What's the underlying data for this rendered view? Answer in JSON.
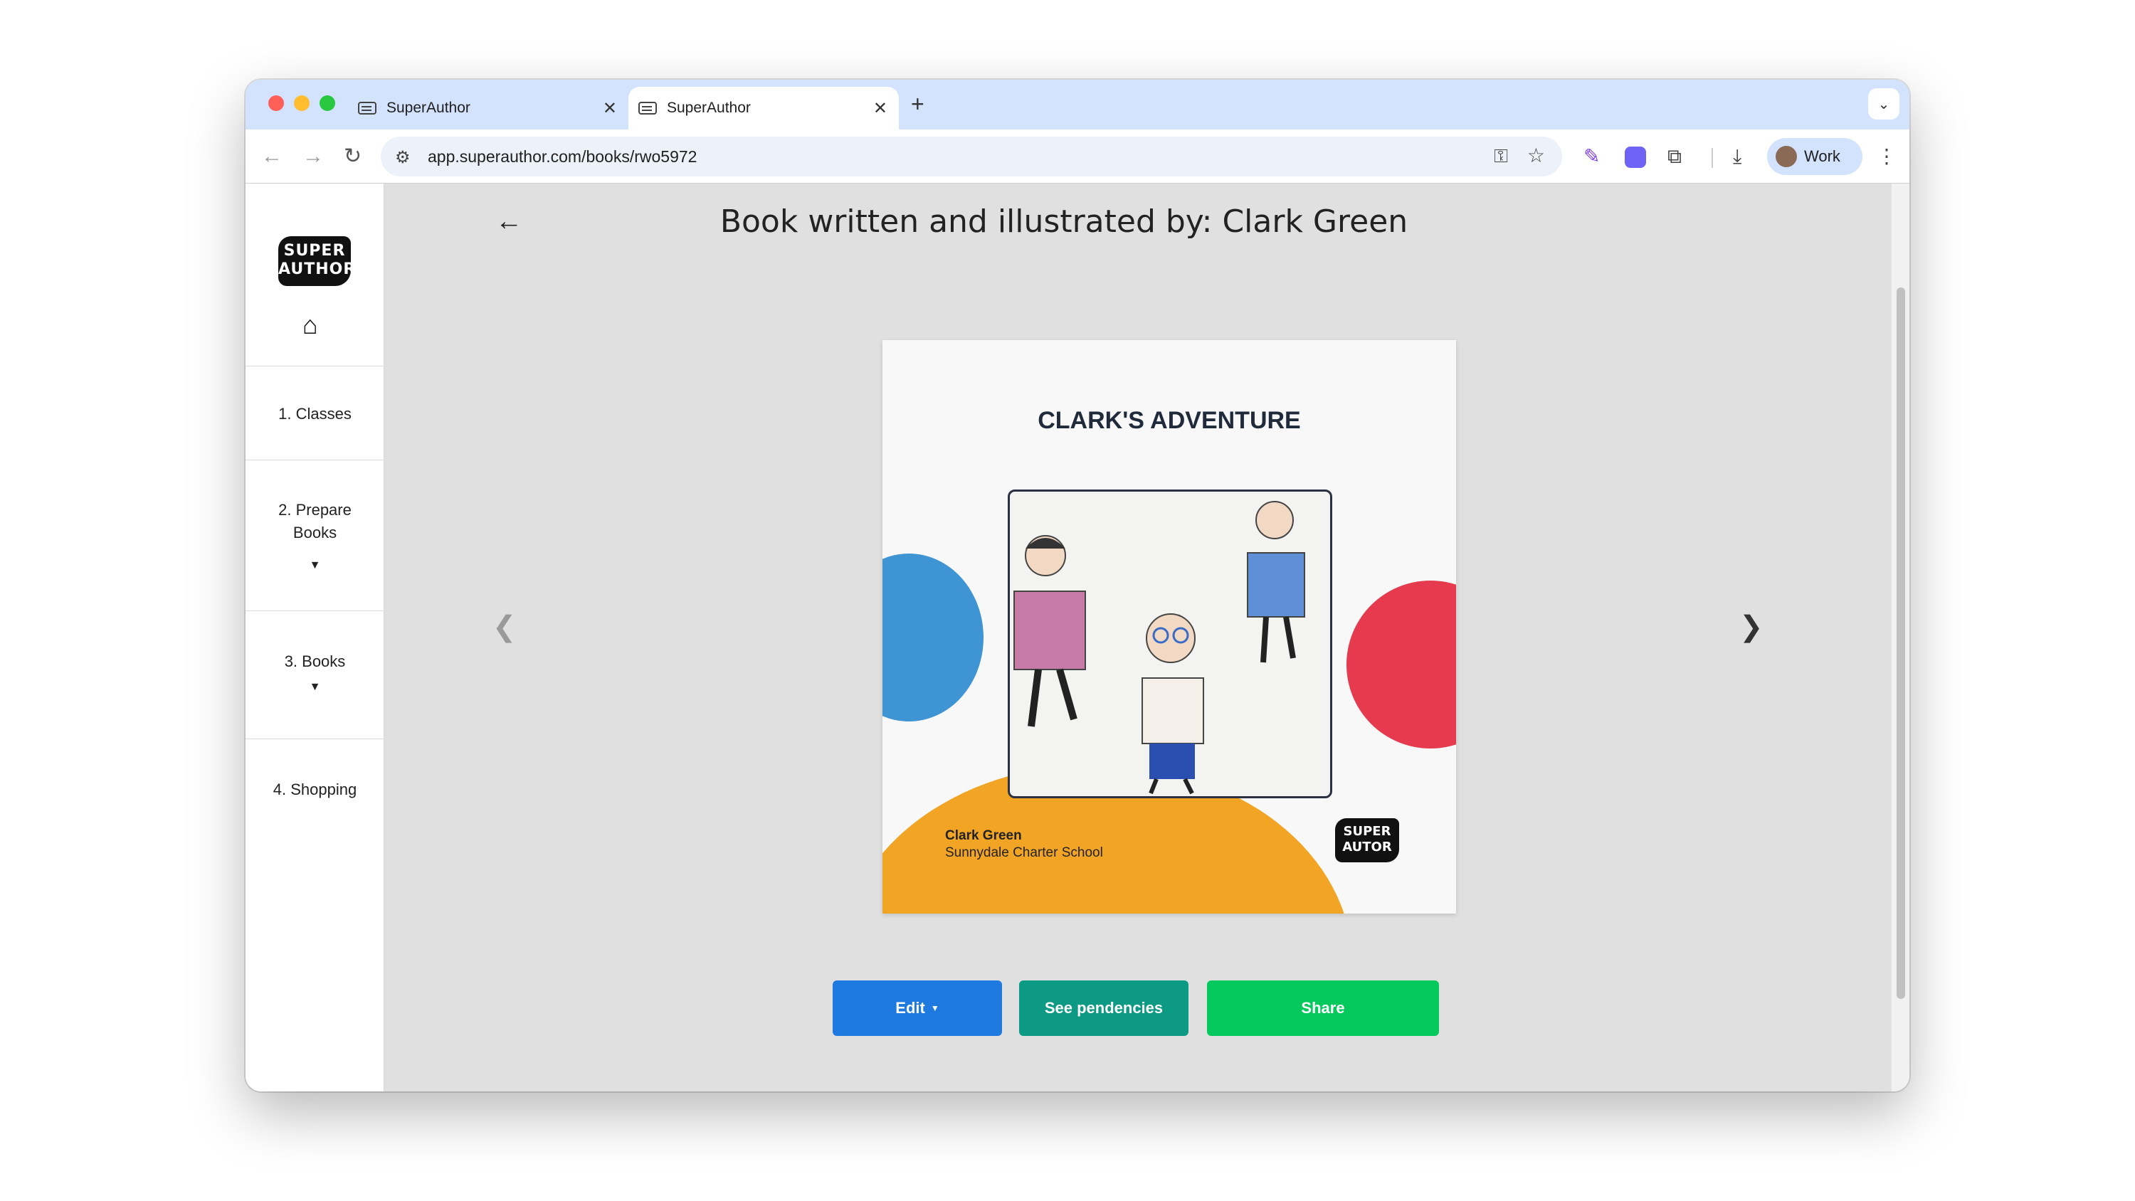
{
  "browser": {
    "tabs": [
      {
        "title": "SuperAuthor",
        "close": "✕"
      },
      {
        "title": "SuperAuthor",
        "close": "✕"
      }
    ],
    "new_tab": "+",
    "tab_search": "⌄",
    "url": "app.superauthor.com/books/rwo5972",
    "profile_label": "Work"
  },
  "sidebar": {
    "logo_text": "SUPER AUTHOR",
    "items": [
      {
        "label": "1. Classes"
      },
      {
        "label": "2. Prepare Books"
      },
      {
        "label": "3. Books"
      },
      {
        "label": "4. Shopping"
      }
    ]
  },
  "main": {
    "title": "Book written and illustrated by: Clark Green",
    "book": {
      "title": "CLARK'S ADVENTURE",
      "author": "Clark Green",
      "school": "Sunnydale Charter School",
      "logo_text": "SUPER AUTOR"
    },
    "buttons": {
      "edit": "Edit",
      "pendencies": "See pendencies",
      "share": "Share"
    }
  },
  "colors": {
    "edit": "#1f7ae0",
    "pendencies": "#0c9a84",
    "share": "#06c95e",
    "orange": "#f2a525",
    "red": "#e63a4f",
    "blue": "#3f95d3"
  }
}
